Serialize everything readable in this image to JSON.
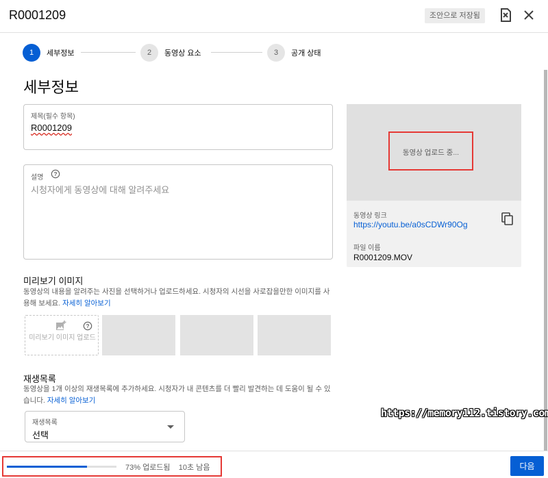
{
  "header": {
    "title": "R0001209",
    "draft_status": "조안으로 저장됨"
  },
  "stepper": {
    "steps": [
      {
        "num": "1",
        "label": "세부정보"
      },
      {
        "num": "2",
        "label": "동영상 요소"
      },
      {
        "num": "3",
        "label": "공개 상태"
      }
    ]
  },
  "details": {
    "heading": "세부정보",
    "title_field": {
      "label": "제목(필수 항목)",
      "value": "R0001209"
    },
    "description_field": {
      "label": "설명",
      "placeholder": "시청자에게 동영상에 대해 알려주세요"
    }
  },
  "thumbnail": {
    "heading": "미리보기 이미지",
    "description": "동영상의 내용을 알려주는 사진을 선택하거나 업로드하세요. 시청자의 시선을 사로잡을만한 이미지를 사용해 보세요.",
    "learn_more": "자세히 알아보기",
    "upload_label": "미리보기 이미지 업로드"
  },
  "playlist": {
    "heading": "재생목록",
    "description": "동영상을 1개 이상의 재생목록에 추가하세요. 시청자가 내 콘텐츠를 더 빨리 발견하는 데 도움이 될 수 있습니다.",
    "learn_more": "자세히 알아보기",
    "select_label": "재생목록",
    "select_value": "선택"
  },
  "video_panel": {
    "uploading": "동영상 업로드 중...",
    "link_label": "동영상 링크",
    "link": "https://youtu.be/a0sCDWr90Og",
    "filename_label": "파일 이름",
    "filename": "R0001209.MOV"
  },
  "footer": {
    "progress_percent": 73,
    "upload_status": "73% 업로드됨",
    "time_left": "10초 남음",
    "next_button": "다음"
  },
  "watermark": "https://memory112.tistory.com",
  "colors": {
    "accent": "#065fd4",
    "highlight": "#e53935"
  }
}
